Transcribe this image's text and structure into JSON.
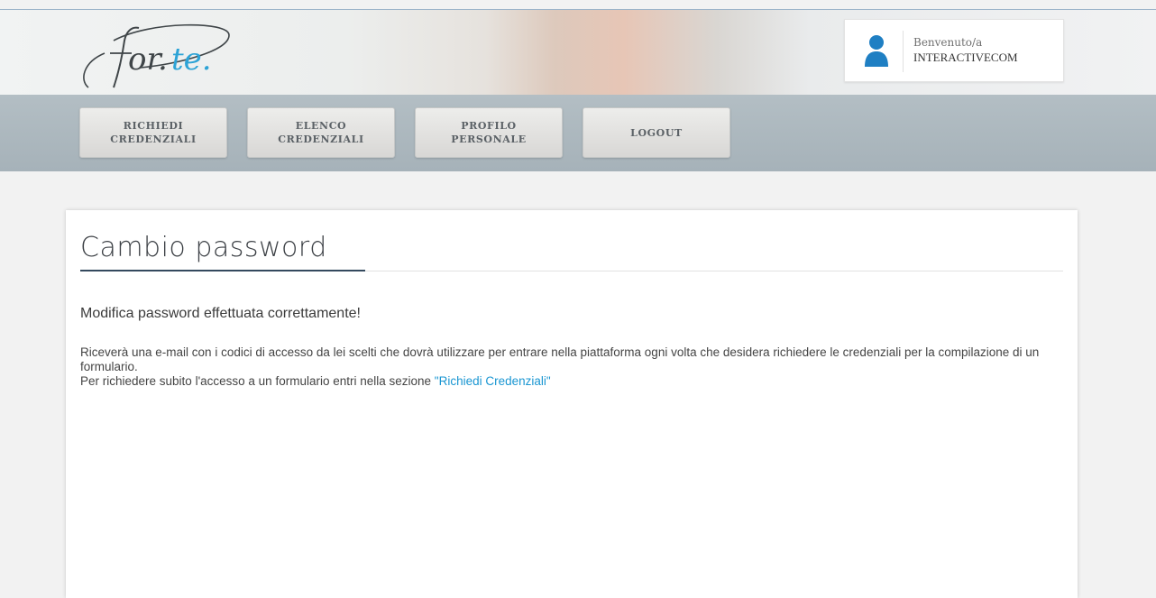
{
  "header": {
    "logo": {
      "text_part1": "for",
      "text_part2": "te",
      "accent_color": "#2da3d6",
      "ink_color": "#3f4548"
    },
    "user": {
      "welcome": "Benvenuto/a",
      "name": "INTERACTIVECOM",
      "avatar_icon": "user-icon",
      "avatar_color": "#1f7fc3"
    }
  },
  "nav": {
    "items": [
      {
        "label": "RICHIEDI\nCREDENZIALI"
      },
      {
        "label": "ELENCO\nCREDENZIALI"
      },
      {
        "label": "PROFILO\nPERSONALE"
      },
      {
        "label": "LOGOUT"
      }
    ]
  },
  "main": {
    "title": "Cambio password",
    "success": "Modifica password effettuata correttamente!",
    "info_line1": "Riceverà una e-mail con i codici di accesso da lei scelti che dovrà utilizzare per entrare nella piattaforma ogni volta che desidera richiedere le credenziali per la compilazione di un formulario.",
    "info_line2_prefix": "Per richiedere subito l'accesso a un formulario entri nella sezione ",
    "info_link": "\"Richiedi Credenziali\"",
    "link_color": "#1a96d2"
  }
}
